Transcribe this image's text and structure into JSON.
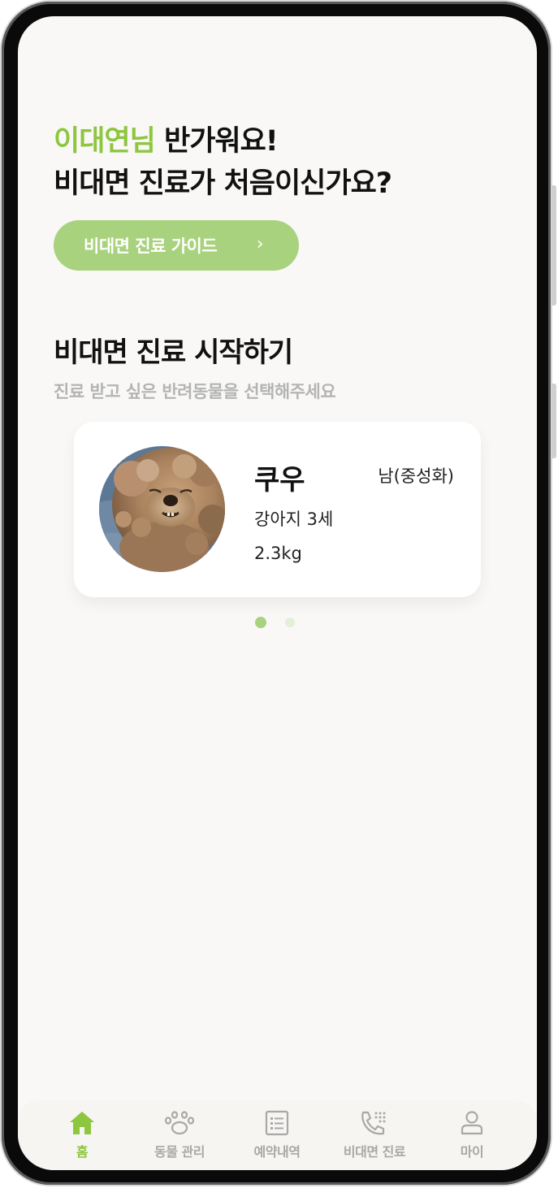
{
  "greeting": {
    "name": "이대연님",
    "line1_rest": " 반가워요!",
    "line2": "비대면 진료가 처음이신가요?"
  },
  "guide_button": {
    "label": "비대면 진료 가이드",
    "chevron": "›"
  },
  "section": {
    "title": "비대면 진료 시작하기",
    "subtitle": "진료 받고 싶은 반려동물을 선택해주세요"
  },
  "pet_card": {
    "name": "쿠우",
    "gender": "남(중성화)",
    "kind_age": "강아지 3세",
    "weight": "2.3kg"
  },
  "carousel": {
    "page_count": 2,
    "active_index": 0
  },
  "tabbar": {
    "items": [
      {
        "label": "홈",
        "icon": "home-icon",
        "active": true
      },
      {
        "label": "동물 관리",
        "icon": "paw-icon",
        "active": false
      },
      {
        "label": "예약내역",
        "icon": "list-icon",
        "active": false
      },
      {
        "label": "비대면 진료",
        "icon": "phone-icon",
        "active": false
      },
      {
        "label": "마이",
        "icon": "user-icon",
        "active": false
      }
    ]
  },
  "colors": {
    "accent": "#8dc63f",
    "button": "#a8d27d",
    "background": "#f9f8f6",
    "muted_text": "#b4b4b4"
  }
}
